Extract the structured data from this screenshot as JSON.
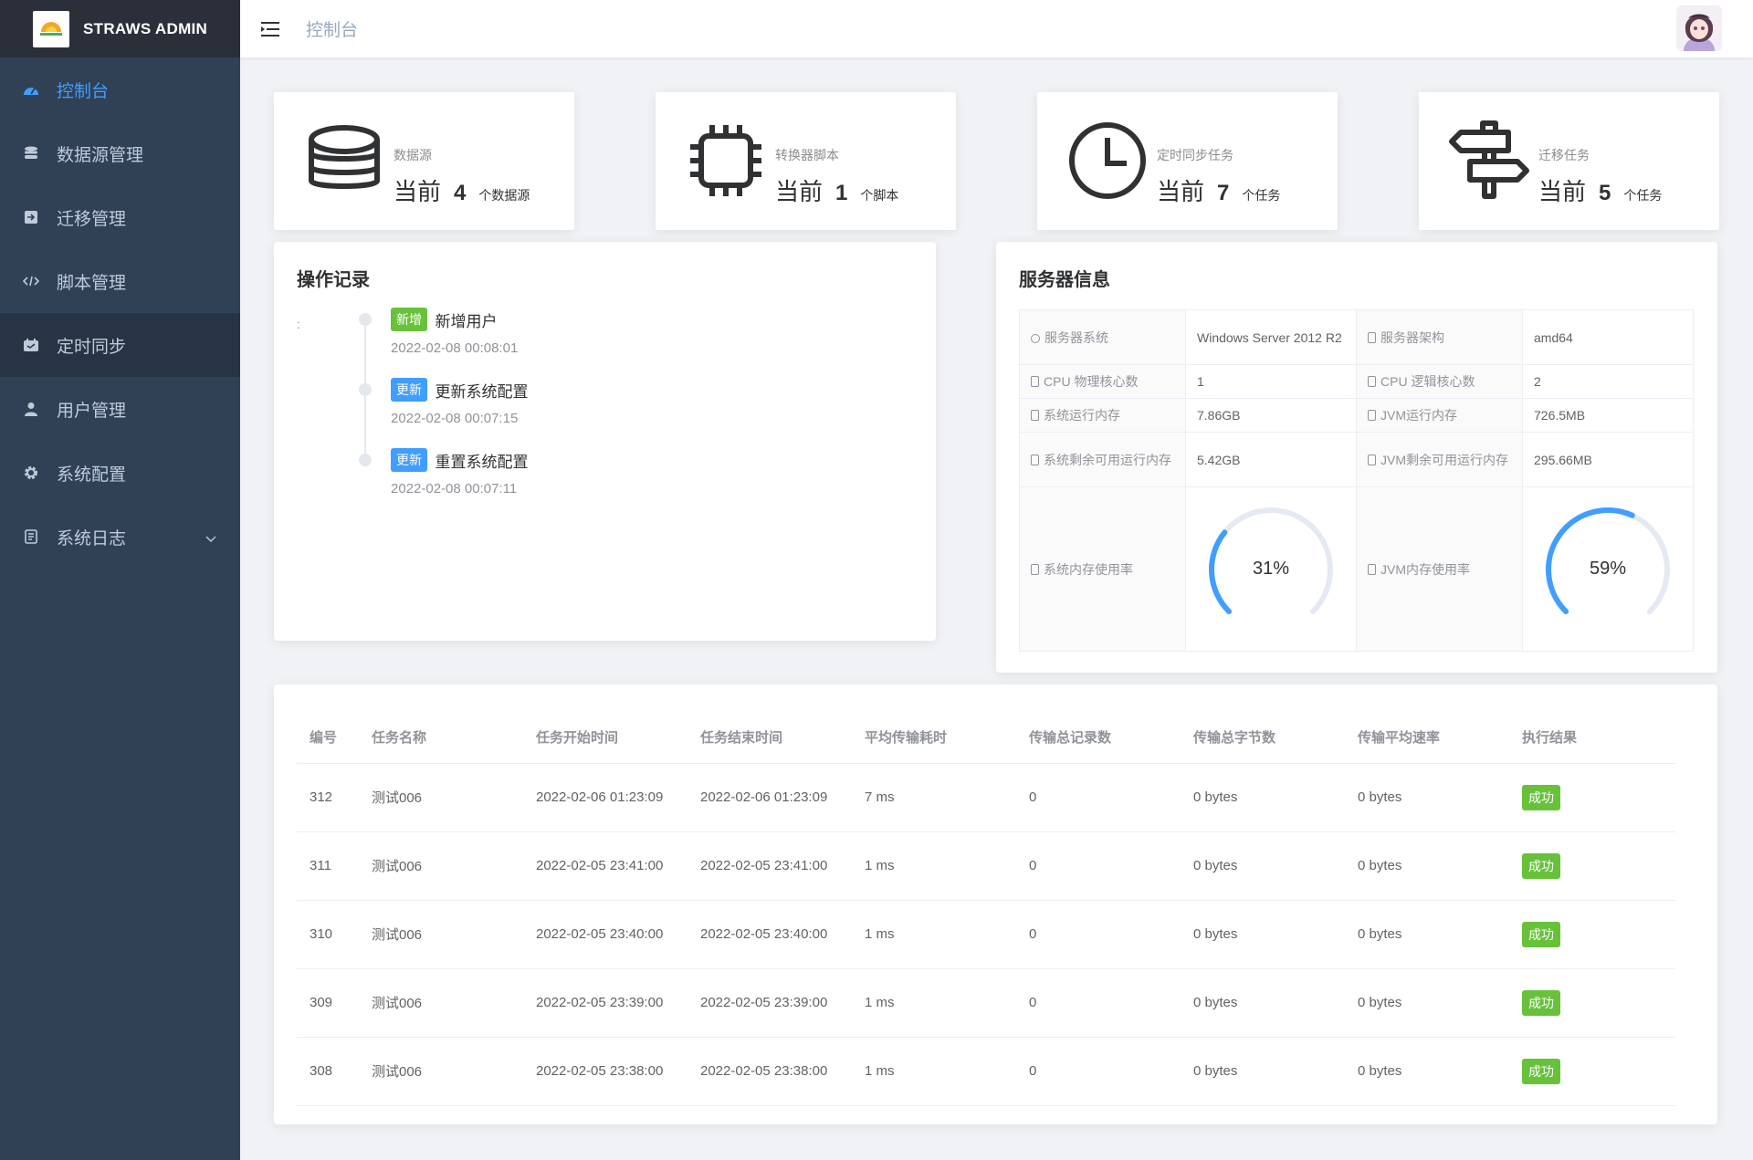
{
  "app": {
    "title": "STRAWS ADMIN"
  },
  "sidebar": {
    "items": [
      {
        "label": "控制台",
        "icon": "dashboard-icon"
      },
      {
        "label": "数据源管理",
        "icon": "database-icon"
      },
      {
        "label": "迁移管理",
        "icon": "import-icon"
      },
      {
        "label": "脚本管理",
        "icon": "code-icon"
      },
      {
        "label": "定时同步",
        "icon": "timer-icon"
      },
      {
        "label": "用户管理",
        "icon": "user-icon"
      },
      {
        "label": "系统配置",
        "icon": "gear-icon"
      },
      {
        "label": "系统日志",
        "icon": "log-icon"
      }
    ]
  },
  "header": {
    "breadcrumb": "控制台"
  },
  "stats": [
    {
      "label": "数据源",
      "prefix": "当前",
      "value": "4",
      "unit": "个数据源",
      "icon": "database-icon"
    },
    {
      "label": "转换器脚本",
      "prefix": "当前",
      "value": "1",
      "unit": "个脚本",
      "icon": "chip-icon"
    },
    {
      "label": "定时同步任务",
      "prefix": "当前",
      "value": "7",
      "unit": "个任务",
      "icon": "clock-icon"
    },
    {
      "label": "迁移任务",
      "prefix": "当前",
      "value": "5",
      "unit": "个任务",
      "icon": "signpost-icon"
    }
  ],
  "operations": {
    "title": "操作记录",
    "colon": ":",
    "items": [
      {
        "tag": "新增",
        "tag_color": "#67c23a",
        "action": "新增用户",
        "time": "2022-02-08 00:08:01"
      },
      {
        "tag": "更新",
        "tag_color": "#409eff",
        "action": "更新系统配置",
        "time": "2022-02-08 00:07:15"
      },
      {
        "tag": "更新",
        "tag_color": "#409eff",
        "action": "重置系统配置",
        "time": "2022-02-08 00:07:11"
      }
    ]
  },
  "server": {
    "title": "服务器信息",
    "rows": [
      {
        "l1": "服务器系统",
        "v1": "Windows Server 2012 R2",
        "l2": "服务器架构",
        "v2": "amd64"
      },
      {
        "l1": "CPU 物理核心数",
        "v1": "1",
        "l2": "CPU 逻辑核心数",
        "v2": "2"
      },
      {
        "l1": "系统运行内存",
        "v1": "7.86GB",
        "l2": "JVM运行内存",
        "v2": "726.5MB"
      },
      {
        "l1": "系统剩余可用运行内存",
        "v1": "5.42GB",
        "l2": "JVM剩余可用运行内存",
        "v2": "295.66MB"
      }
    ],
    "gauges": {
      "sys_label": "系统内存使用率",
      "sys_text": "31%",
      "sys_value": 0.31,
      "jvm_label": "JVM内存使用率",
      "jvm_text": "59%",
      "jvm_value": 0.59
    }
  },
  "tasks": {
    "headers": [
      "编号",
      "任务名称",
      "任务开始时间",
      "任务结束时间",
      "平均传输耗时",
      "传输总记录数",
      "传输总字节数",
      "传输平均速率",
      "执行结果"
    ],
    "rows": [
      [
        "312",
        "测试006",
        "2022-02-06 01:23:09",
        "2022-02-06 01:23:09",
        "7 ms",
        "0",
        "0 bytes",
        "0 bytes",
        "成功"
      ],
      [
        "311",
        "测试006",
        "2022-02-05 23:41:00",
        "2022-02-05 23:41:00",
        "1 ms",
        "0",
        "0 bytes",
        "0 bytes",
        "成功"
      ],
      [
        "310",
        "测试006",
        "2022-02-05 23:40:00",
        "2022-02-05 23:40:00",
        "1 ms",
        "0",
        "0 bytes",
        "0 bytes",
        "成功"
      ],
      [
        "309",
        "测试006",
        "2022-02-05 23:39:00",
        "2022-02-05 23:39:00",
        "1 ms",
        "0",
        "0 bytes",
        "0 bytes",
        "成功"
      ],
      [
        "308",
        "测试006",
        "2022-02-05 23:38:00",
        "2022-02-05 23:38:00",
        "1 ms",
        "0",
        "0 bytes",
        "0 bytes",
        "成功"
      ]
    ]
  },
  "colors": {
    "accent": "#409eff",
    "sidebar": "#304156",
    "success": "#67c23a"
  }
}
